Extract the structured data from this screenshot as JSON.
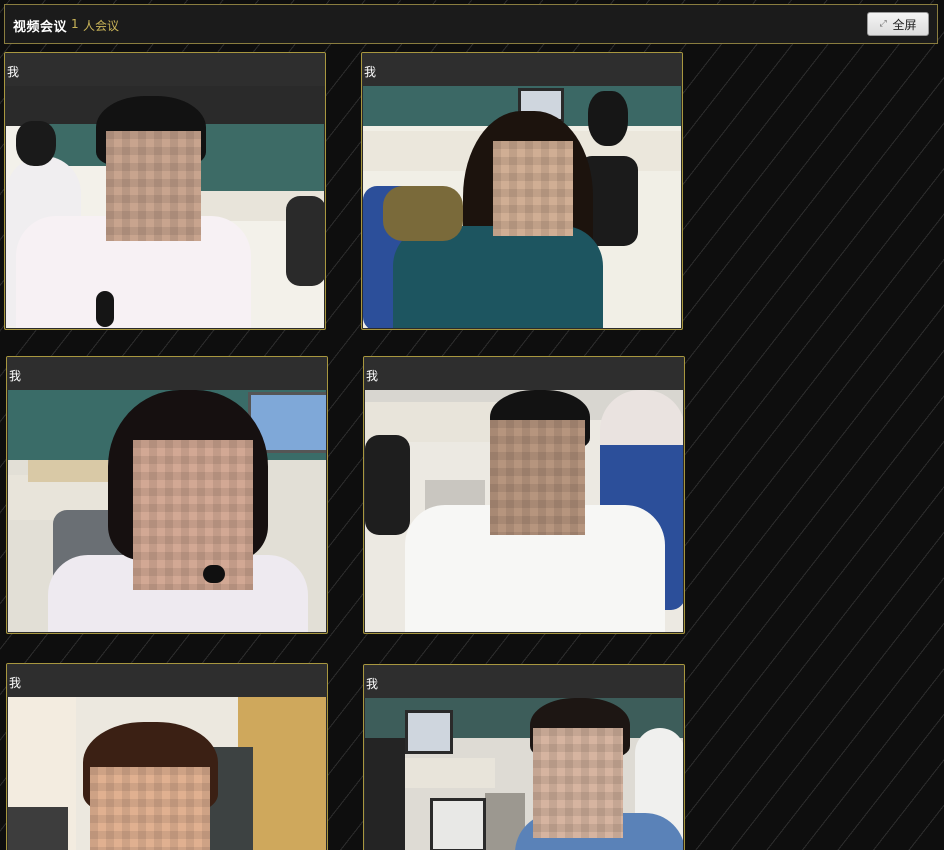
{
  "header": {
    "title": "视频会议",
    "count": "1",
    "meeting_label": "人会议",
    "fullscreen_label": "全屏"
  },
  "tiles": [
    {
      "name": "我"
    },
    {
      "name": "我"
    },
    {
      "name": "我"
    },
    {
      "name": "我"
    },
    {
      "name": "我"
    },
    {
      "name": "我"
    }
  ],
  "colors": {
    "background": "#0e0e0e",
    "border_gold": "#a8973f",
    "meeting_text": "#c9b458",
    "tile_header": "#2e2e2e"
  }
}
